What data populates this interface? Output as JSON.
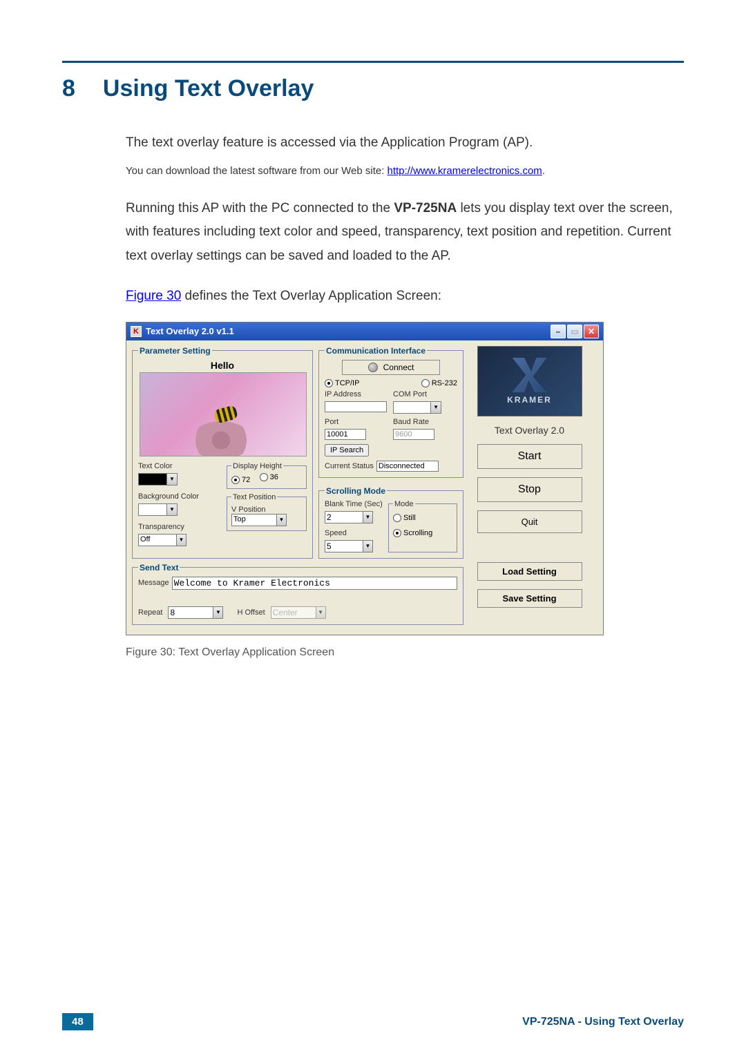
{
  "chapter": {
    "num": "8",
    "title": "Using Text Overlay"
  },
  "para1": "The text overlay feature is accessed via the Application Program (AP).",
  "note_prefix": "You can download the latest software from our Web site: ",
  "note_link": "http://www.kramerelectronics.com",
  "note_suffix": ".",
  "para2_a": "Running this AP with the PC connected to the ",
  "para2_bold": "VP-725NA",
  "para2_b": " lets you display text over the screen, with features including text color and speed, transparency, text position and repetition. Current text overlay settings can be saved and loaded to the AP.",
  "figref_a": "Figure 30",
  "figref_b": " defines the Text Overlay Application Screen:",
  "app": {
    "title": "Text Overlay 2.0  v1.1",
    "param_legend": "Parameter Setting",
    "preview_overlay": "Hello",
    "labels": {
      "text_color": "Text Color",
      "bg_color": "Background Color",
      "transparency": "Transparency",
      "display_height": "Display Height",
      "text_position": "Text Position",
      "v_position": "V Position"
    },
    "transparency_value": "Off",
    "display_height_opts": {
      "a": "72",
      "b": "36"
    },
    "vpos_value": "Top",
    "comm": {
      "legend": "Communication Interface",
      "connect": "Connect",
      "tcpip": "TCP/IP",
      "rs232": "RS-232",
      "ip_addr": "IP Address",
      "com_port": "COM Port",
      "port": "Port",
      "port_value": "10001",
      "baud": "Baud Rate",
      "baud_value": "9600",
      "ip_search": "IP Search",
      "current_status": "Current Status",
      "status_value": "Disconnected"
    },
    "scroll": {
      "legend": "Scrolling Mode",
      "blank_time": "Blank Time (Sec)",
      "blank_value": "2",
      "speed": "Speed",
      "speed_value": "5",
      "mode_legend": "Mode",
      "still": "Still",
      "scrolling": "Scrolling"
    },
    "send": {
      "legend": "Send Text",
      "message_label": "Message",
      "message_value": "Welcome to Kramer Electronics",
      "repeat_label": "Repeat",
      "repeat_value": "8",
      "hoffset_label": "H Offset",
      "hoffset_value": "Center"
    },
    "right": {
      "brand": "KRAMER",
      "product": "Text Overlay 2.0",
      "start": "Start",
      "stop": "Stop",
      "quit": "Quit",
      "load": "Load Setting",
      "save": "Save Setting"
    }
  },
  "figure_caption": "Figure 30: Text Overlay Application Screen",
  "footer": {
    "page": "48",
    "label": "VP-725NA - Using Text Overlay"
  }
}
